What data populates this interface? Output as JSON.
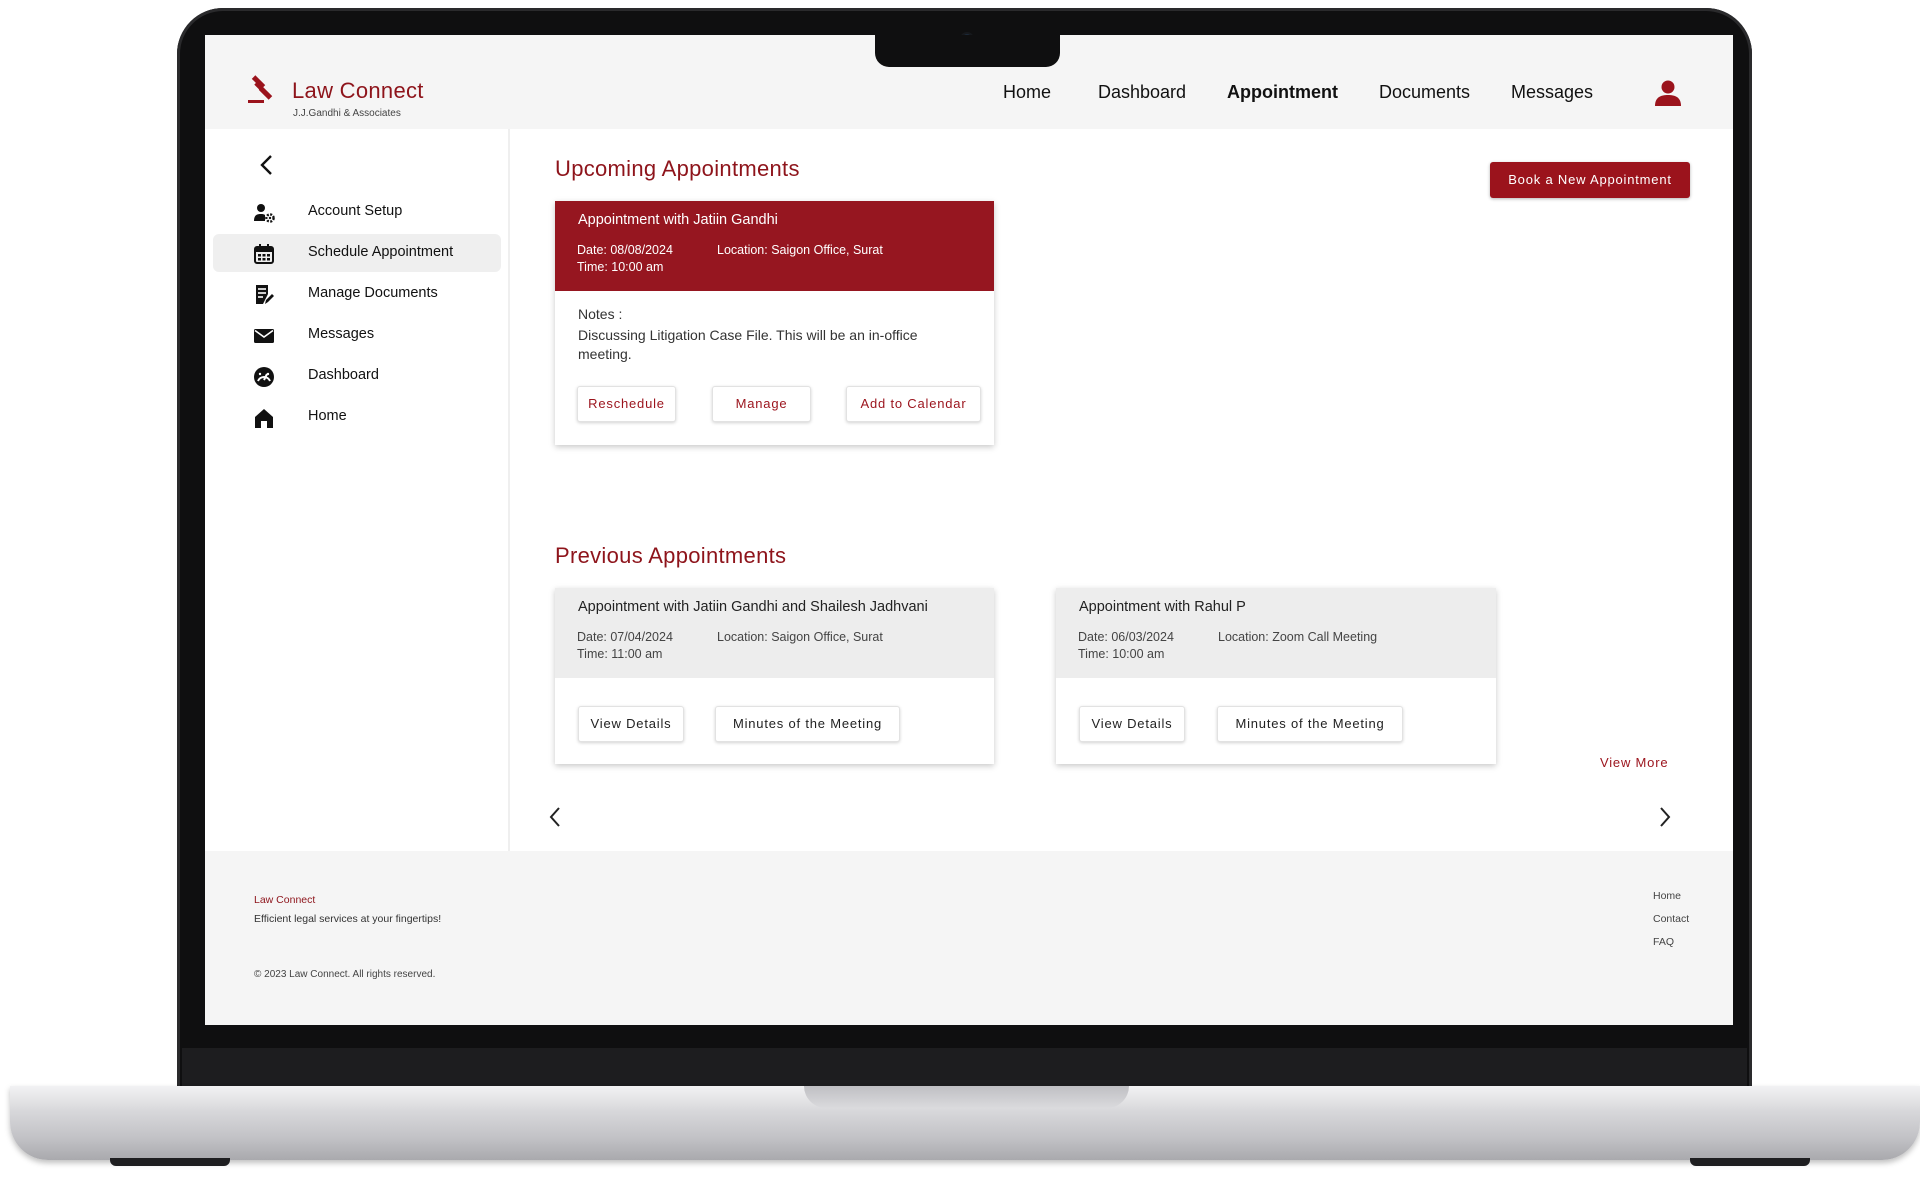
{
  "brand": {
    "name": "Law Connect",
    "subtitle": "J.J.Gandhi & Associates"
  },
  "nav": {
    "items": [
      "Home",
      "Dashboard",
      "Appointment",
      "Documents",
      "Messages"
    ],
    "active": "Appointment",
    "user_icon": "user-icon"
  },
  "sidebar": {
    "back_icon": "chevron-left-icon",
    "items": [
      {
        "label": "Account Setup",
        "icon": "user-gear-icon"
      },
      {
        "label": "Schedule Appointment",
        "icon": "calendar-icon",
        "active": true
      },
      {
        "label": "Manage Documents",
        "icon": "document-edit-icon"
      },
      {
        "label": "Messages",
        "icon": "envelope-icon"
      },
      {
        "label": "Dashboard",
        "icon": "gauge-icon"
      },
      {
        "label": "Home",
        "icon": "home-icon"
      }
    ]
  },
  "upcoming": {
    "heading": "Upcoming Appointments",
    "book_button": "Book a New Appointment",
    "card": {
      "title": "Appointment with Jatiin Gandhi",
      "date": "Date: 08/08/2024",
      "location": "Location: Saigon Office, Surat",
      "time": "Time: 10:00 am",
      "notes_label": "Notes :",
      "notes": "Discussing Litigation Case File. This will be an in-office meeting.",
      "buttons": [
        "Reschedule",
        "Manage",
        "Add to Calendar"
      ]
    }
  },
  "previous": {
    "heading": "Previous Appointments",
    "cards": [
      {
        "title": "Appointment with Jatiin Gandhi and Shailesh Jadhvani",
        "date": "Date: 07/04/2024",
        "location": "Location: Saigon Office, Surat",
        "time": "Time: 11:00 am",
        "buttons": [
          "View Details",
          "Minutes of the Meeting"
        ]
      },
      {
        "title": "Appointment with Rahul P",
        "date": "Date: 06/03/2024",
        "location": "Location: Zoom Call Meeting",
        "time": "Time: 10:00 am",
        "buttons": [
          "View Details",
          "Minutes of the Meeting"
        ]
      }
    ],
    "view_more": "View More"
  },
  "footer": {
    "brand": "Law Connect",
    "tagline": "Efficient legal services at your fingertips!",
    "copyright": "© 2023 Law Connect. All rights reserved.",
    "links": [
      "Home",
      "Contact",
      "FAQ"
    ]
  },
  "colors": {
    "accent": "#9b131c",
    "card_header": "#961620",
    "background": "#f5f5f5"
  }
}
